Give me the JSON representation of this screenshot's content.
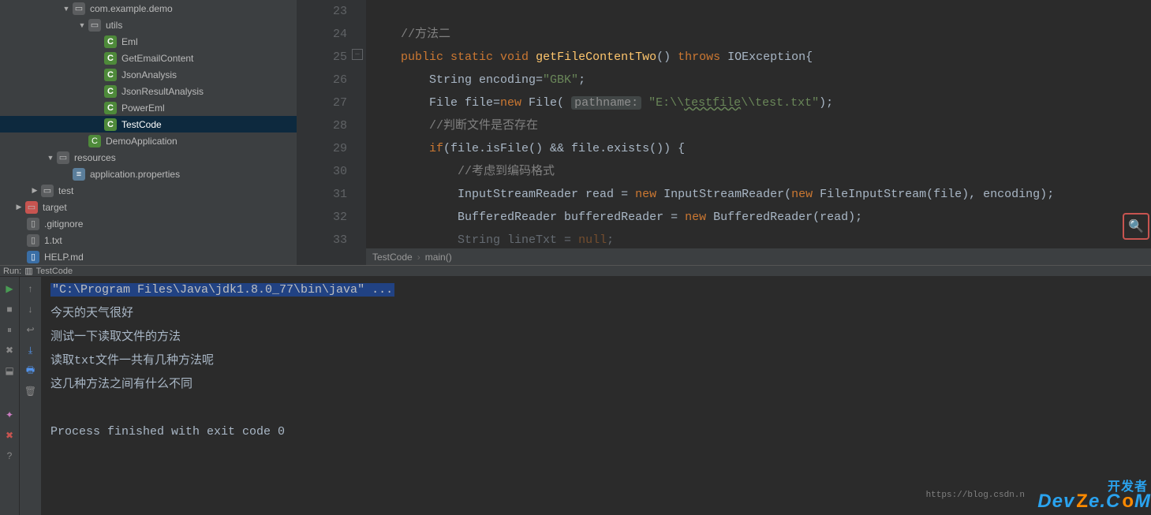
{
  "tree": {
    "pkg_com": "com.example.demo",
    "pkg_utils": "utils",
    "cls_eml": "Eml",
    "cls_getemail": "GetEmailContent",
    "cls_jsonana": "JsonAnalysis",
    "cls_jsonres": "JsonResultAnalysis",
    "cls_powereml": "PowerEml",
    "cls_testcode": "TestCode",
    "cls_demoapp": "DemoApplication",
    "dir_resources": "resources",
    "file_appprops": "application.properties",
    "dir_test": "test",
    "dir_target": "target",
    "file_gitignore": ".gitignore",
    "file_1txt": "1.txt",
    "file_helpmd": "HELP.md"
  },
  "gutter": {
    "l23": "23",
    "l24": "24",
    "l25": "25",
    "l26": "26",
    "l27": "27",
    "l28": "28",
    "l29": "29",
    "l30": "30",
    "l31": "31",
    "l32": "32",
    "l33": "33"
  },
  "code": {
    "c24": "//方法二",
    "c25_public": "public ",
    "c25_static": "static ",
    "c25_void": "void ",
    "c25_fn": "getFileContentTwo",
    "c25_rest": "() ",
    "c25_throws": "throws ",
    "c25_ex": "IOException{",
    "c26_a": "String encoding=",
    "c26_str": "\"GBK\"",
    "c26_b": ";",
    "c27_a": "File file=",
    "c27_new": "new ",
    "c27_b": "File( ",
    "c27_hint": "pathname:",
    "c27_sp": " ",
    "c27_str1": "\"E:",
    "c27_str2": "\\\\",
    "c27_str3": "testfile",
    "c27_str4": "\\\\",
    "c27_str5": "test.txt\"",
    "c27_c": ");",
    "c28": "//判断文件是否存在",
    "c29_if": "if",
    "c29_rest": "(file.isFile() && file.exists()) {",
    "c30": "//考虑到编码格式",
    "c31_a": "InputStreamReader read = ",
    "c31_new": "new ",
    "c31_b": "InputStreamReader(",
    "c31_new2": "new ",
    "c31_c": "FileInputStream(file), encoding);",
    "c32_a": "BufferedReader bufferedReader = ",
    "c32_new": "new ",
    "c32_b": "BufferedReader(read);",
    "c33_a": "String lineTxt = ",
    "c33_null": "null",
    "c33_b": ";"
  },
  "breadcrumbs": {
    "a": "TestCode",
    "b": "main()"
  },
  "run_header": {
    "label": "Run:",
    "config": "TestCode"
  },
  "console": {
    "cmd": "\"C:\\Program Files\\Java\\jdk1.8.0_77\\bin\\java\" ...",
    "l1": "今天的天气很好",
    "l2": "测试一下读取文件的方法",
    "l3": "读取txt文件一共有几种方法呢",
    "l4": "这几种方法之间有什么不同",
    "exit": "Process finished with exit code 0"
  },
  "watermark": {
    "cn": "开发者",
    "en1": "Dev",
    "en2": "Z",
    "en3": "e.C",
    "en4": "o",
    "en5": "M",
    "url": "https://blog.csdn.n"
  }
}
